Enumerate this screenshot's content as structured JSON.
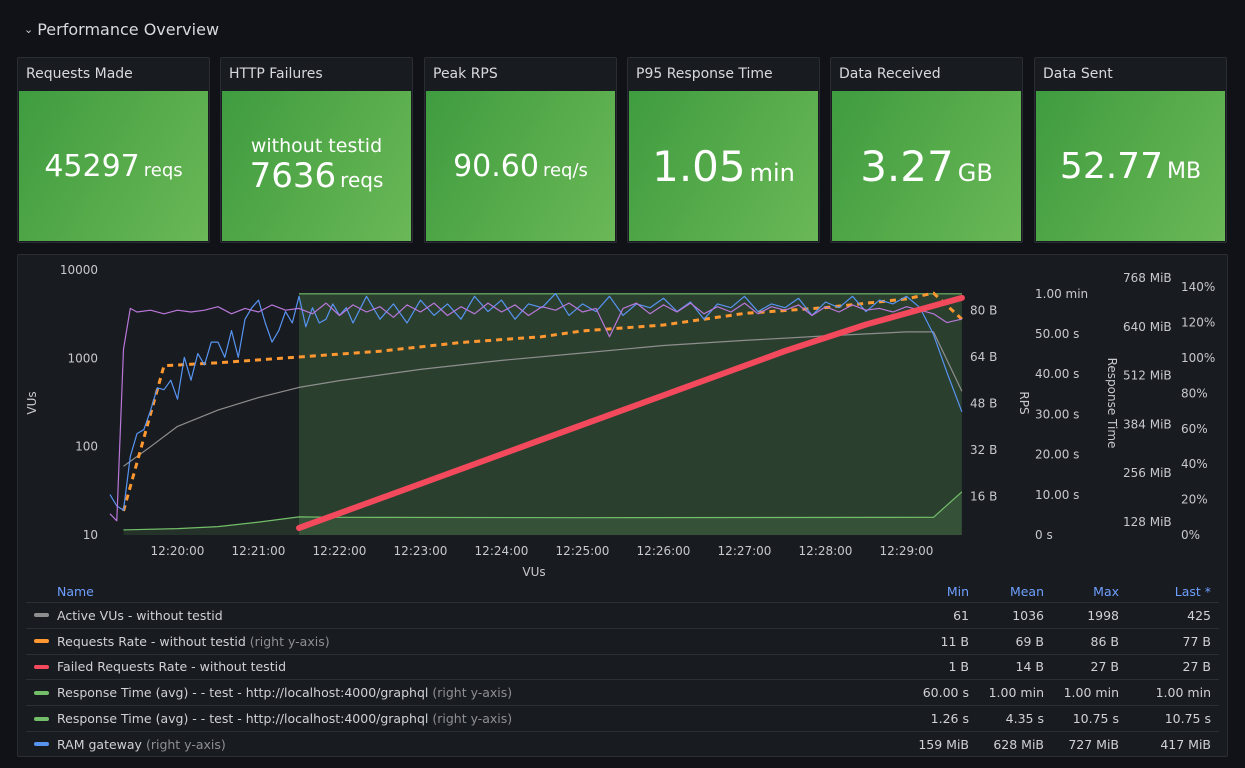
{
  "row": {
    "title": "Performance Overview",
    "icon": "chevron-down-icon"
  },
  "stats": [
    {
      "title": "Requests Made",
      "value": "45297",
      "unit": "reqs"
    },
    {
      "title": "HTTP Failures",
      "subtitle": "without testid",
      "value": "7636",
      "unit": "reqs"
    },
    {
      "title": "Peak RPS",
      "value": "90.60",
      "unit": "req/s"
    },
    {
      "title": "P95 Response Time",
      "value": "1.05",
      "unit": "min"
    },
    {
      "title": "Data Received",
      "value": "3.27",
      "unit": "GB"
    },
    {
      "title": "Data Sent",
      "value": "52.77",
      "unit": "MB"
    }
  ],
  "colors": {
    "stat_green": "#56a64b",
    "vus": "#8e8e8e",
    "requests": "#ff9830",
    "failed": "#f2495c",
    "response": "#73bf69",
    "ram": "#5794f2",
    "purple": "#b877d9"
  },
  "chart_data": {
    "type": "line",
    "xlabel": "VUs",
    "x_ticks": [
      "12:20:00",
      "12:21:00",
      "12:22:00",
      "12:23:00",
      "12:24:00",
      "12:25:00",
      "12:26:00",
      "12:27:00",
      "12:28:00",
      "12:29:00"
    ],
    "x_range": [
      "12:19:10",
      "12:29:41"
    ],
    "axes": {
      "vus": {
        "label": "VUs",
        "scale": "log",
        "range": [
          10,
          10000
        ],
        "ticks": [
          "10",
          "100",
          "1000",
          "10000"
        ],
        "side": "left"
      },
      "bytes": {
        "label": "RPS",
        "scale": "linear",
        "ticks": [
          "16 B",
          "32 B",
          "48 B",
          "64 B",
          "80 B"
        ],
        "side": "right"
      },
      "time": {
        "label": "",
        "scale": "linear",
        "range": [
          0,
          60
        ],
        "ticks": [
          "0 s",
          "10.00 s",
          "20.00 s",
          "30.00 s",
          "40.00 s",
          "50.00 s",
          "1.00 min"
        ],
        "side": "right"
      },
      "mib": {
        "label": "Response Time",
        "scale": "linear",
        "ticks": [
          "128 MiB",
          "256 MiB",
          "384 MiB",
          "512 MiB",
          "640 MiB",
          "768 MiB"
        ],
        "side": "right"
      },
      "percent": {
        "label": "",
        "scale": "linear",
        "range": [
          0,
          140
        ],
        "ticks": [
          "0%",
          "20%",
          "40%",
          "60%",
          "80%",
          "100%",
          "120%",
          "140%"
        ],
        "side": "right"
      }
    },
    "series": [
      {
        "name": "Active VUs - without testid",
        "axis": "vus",
        "color": "#8e8e8e",
        "style": "solid",
        "points": [
          [
            "12:19:20",
            60
          ],
          [
            "12:19:40",
            100
          ],
          [
            "12:20:00",
            170
          ],
          [
            "12:20:30",
            260
          ],
          [
            "12:21:00",
            360
          ],
          [
            "12:21:30",
            470
          ],
          [
            "12:22:00",
            560
          ],
          [
            "12:23:00",
            750
          ],
          [
            "12:24:00",
            950
          ],
          [
            "12:25:00",
            1150
          ],
          [
            "12:26:00",
            1400
          ],
          [
            "12:27:00",
            1600
          ],
          [
            "12:28:00",
            1800
          ],
          [
            "12:29:00",
            1998
          ],
          [
            "12:29:20",
            1998
          ],
          [
            "12:29:41",
            425
          ]
        ]
      },
      {
        "name": "Requests Rate - without testid",
        "axis_note": "(right y-axis)",
        "axis": "bytes",
        "color": "#ff9830",
        "style": "dashed",
        "points": [
          [
            "12:19:20",
            11
          ],
          [
            "12:19:50",
            61
          ],
          [
            "12:20:30",
            62
          ],
          [
            "12:21:30",
            64
          ],
          [
            "12:22:30",
            66
          ],
          [
            "12:23:30",
            69
          ],
          [
            "12:24:30",
            71
          ],
          [
            "12:25:00",
            73
          ],
          [
            "12:26:00",
            75
          ],
          [
            "12:27:00",
            79
          ],
          [
            "12:28:00",
            81
          ],
          [
            "12:29:00",
            84
          ],
          [
            "12:29:20",
            86
          ],
          [
            "12:29:41",
            77
          ]
        ]
      },
      {
        "name": "Failed Requests Rate - without testid",
        "axis": "failed",
        "color": "#f2495c",
        "style": "thick",
        "points": [
          [
            "12:21:30",
            1
          ],
          [
            "12:23:00",
            6
          ],
          [
            "12:24:30",
            11
          ],
          [
            "12:26:00",
            16
          ],
          [
            "12:27:30",
            21
          ],
          [
            "12:28:30",
            24
          ],
          [
            "12:29:41",
            27
          ]
        ]
      },
      {
        "name": "Response Time (avg) - - test - http://localhost:4000/graphql",
        "axis_note": "(right y-axis)",
        "axis": "time",
        "color": "#73bf69",
        "style": "fill",
        "points": [
          [
            "12:21:30",
            60
          ],
          [
            "12:29:41",
            60
          ]
        ]
      },
      {
        "name": "Response Time (avg) - - test - http://localhost:4000/graphql",
        "axis_note": "(right y-axis)",
        "axis": "time",
        "color": "#73bf69",
        "style": "solid",
        "points": [
          [
            "12:19:20",
            1.26
          ],
          [
            "12:20:00",
            1.6
          ],
          [
            "12:20:30",
            2.1
          ],
          [
            "12:21:00",
            3.2
          ],
          [
            "12:21:30",
            4.5
          ],
          [
            "12:22:00",
            4.4
          ],
          [
            "12:25:00",
            4.3
          ],
          [
            "12:29:20",
            4.4
          ],
          [
            "12:29:41",
            10.75
          ]
        ]
      },
      {
        "name": "RAM gateway",
        "axis_note": "(right y-axis)",
        "axis": "mib",
        "color": "#5794f2",
        "style": "solid",
        "points": [
          [
            "12:19:10",
            200
          ],
          [
            "12:19:15",
            170
          ],
          [
            "12:19:20",
            159
          ],
          [
            "12:19:25",
            300
          ],
          [
            "12:19:30",
            360
          ],
          [
            "12:19:35",
            370
          ],
          [
            "12:19:40",
            420
          ],
          [
            "12:19:45",
            480
          ],
          [
            "12:19:50",
            475
          ],
          [
            "12:19:55",
            500
          ],
          [
            "12:20:00",
            450
          ],
          [
            "12:20:05",
            560
          ],
          [
            "12:20:10",
            500
          ],
          [
            "12:20:15",
            570
          ],
          [
            "12:20:20",
            540
          ],
          [
            "12:20:25",
            600
          ],
          [
            "12:20:30",
            600
          ],
          [
            "12:20:35",
            560
          ],
          [
            "12:20:40",
            630
          ],
          [
            "12:20:45",
            560
          ],
          [
            "12:20:50",
            660
          ],
          [
            "12:20:55",
            690
          ],
          [
            "12:21:00",
            710
          ],
          [
            "12:21:05",
            650
          ],
          [
            "12:21:10",
            600
          ],
          [
            "12:21:15",
            630
          ],
          [
            "12:21:20",
            680
          ],
          [
            "12:21:25",
            650
          ],
          [
            "12:21:30",
            720
          ],
          [
            "12:21:35",
            640
          ],
          [
            "12:21:40",
            690
          ],
          [
            "12:21:45",
            650
          ],
          [
            "12:21:50",
            660
          ],
          [
            "12:21:55",
            700
          ],
          [
            "12:22:00",
            670
          ],
          [
            "12:22:05",
            690
          ],
          [
            "12:22:10",
            650
          ],
          [
            "12:22:20",
            720
          ],
          [
            "12:22:30",
            660
          ],
          [
            "12:22:40",
            700
          ],
          [
            "12:22:50",
            650
          ],
          [
            "12:23:00",
            710
          ],
          [
            "12:23:10",
            670
          ],
          [
            "12:23:20",
            700
          ],
          [
            "12:23:30",
            660
          ],
          [
            "12:23:40",
            720
          ],
          [
            "12:23:50",
            680
          ],
          [
            "12:24:00",
            710
          ],
          [
            "12:24:10",
            660
          ],
          [
            "12:24:20",
            700
          ],
          [
            "12:24:30",
            690
          ],
          [
            "12:24:40",
            727
          ],
          [
            "12:24:50",
            670
          ],
          [
            "12:25:00",
            700
          ],
          [
            "12:25:10",
            680
          ],
          [
            "12:25:20",
            720
          ],
          [
            "12:25:30",
            670
          ],
          [
            "12:25:40",
            700
          ],
          [
            "12:25:50",
            690
          ],
          [
            "12:26:00",
            715
          ],
          [
            "12:26:10",
            680
          ],
          [
            "12:26:20",
            705
          ],
          [
            "12:26:30",
            660
          ],
          [
            "12:26:40",
            700
          ],
          [
            "12:26:50",
            690
          ],
          [
            "12:27:00",
            720
          ],
          [
            "12:27:10",
            680
          ],
          [
            "12:27:20",
            700
          ],
          [
            "12:27:30",
            690
          ],
          [
            "12:27:40",
            715
          ],
          [
            "12:27:50",
            670
          ],
          [
            "12:28:00",
            705
          ],
          [
            "12:28:10",
            690
          ],
          [
            "12:28:20",
            720
          ],
          [
            "12:28:30",
            680
          ],
          [
            "12:28:40",
            710
          ],
          [
            "12:28:50",
            700
          ],
          [
            "12:29:00",
            720
          ],
          [
            "12:29:10",
            690
          ],
          [
            "12:29:20",
            620
          ],
          [
            "12:29:30",
            520
          ],
          [
            "12:29:41",
            417
          ]
        ]
      },
      {
        "axis": "percent",
        "color": "#b877d9",
        "style": "solid",
        "points": [
          [
            "12:19:10",
            12
          ],
          [
            "12:19:15",
            8
          ],
          [
            "12:19:20",
            105
          ],
          [
            "12:19:25",
            128
          ],
          [
            "12:19:30",
            126
          ],
          [
            "12:19:40",
            127
          ],
          [
            "12:19:50",
            125
          ],
          [
            "12:20:00",
            127
          ],
          [
            "12:20:10",
            126
          ],
          [
            "12:20:20",
            127
          ],
          [
            "12:20:30",
            129
          ],
          [
            "12:20:40",
            125
          ],
          [
            "12:20:50",
            128
          ],
          [
            "12:21:00",
            126
          ],
          [
            "12:21:10",
            130
          ],
          [
            "12:21:20",
            127
          ],
          [
            "12:21:30",
            128
          ],
          [
            "12:21:40",
            125
          ],
          [
            "12:21:50",
            131
          ],
          [
            "12:22:00",
            124
          ],
          [
            "12:22:10",
            130
          ],
          [
            "12:22:20",
            126
          ],
          [
            "12:22:30",
            129
          ],
          [
            "12:22:40",
            123
          ],
          [
            "12:22:50",
            130
          ],
          [
            "12:23:00",
            126
          ],
          [
            "12:23:10",
            131
          ],
          [
            "12:23:20",
            124
          ],
          [
            "12:23:30",
            129
          ],
          [
            "12:23:40",
            125
          ],
          [
            "12:23:50",
            131
          ],
          [
            "12:24:00",
            126
          ],
          [
            "12:24:10",
            130
          ],
          [
            "12:24:20",
            124
          ],
          [
            "12:24:30",
            129
          ],
          [
            "12:24:40",
            127
          ],
          [
            "12:24:50",
            131
          ],
          [
            "12:25:00",
            126
          ],
          [
            "12:25:10",
            128
          ],
          [
            "12:25:20",
            112
          ],
          [
            "12:25:30",
            128
          ],
          [
            "12:25:40",
            131
          ],
          [
            "12:25:50",
            125
          ],
          [
            "12:26:00",
            130
          ],
          [
            "12:26:10",
            126
          ],
          [
            "12:26:20",
            131
          ],
          [
            "12:26:30",
            125
          ],
          [
            "12:26:40",
            129
          ],
          [
            "12:26:50",
            126
          ],
          [
            "12:27:00",
            131
          ],
          [
            "12:27:10",
            125
          ],
          [
            "12:27:20",
            129
          ],
          [
            "12:27:30",
            127
          ],
          [
            "12:27:40",
            130
          ],
          [
            "12:27:50",
            124
          ],
          [
            "12:28:00",
            129
          ],
          [
            "12:28:10",
            126
          ],
          [
            "12:28:20",
            130
          ],
          [
            "12:28:30",
            127
          ],
          [
            "12:28:40",
            128
          ],
          [
            "12:28:50",
            126
          ],
          [
            "12:29:00",
            129
          ],
          [
            "12:29:10",
            127
          ],
          [
            "12:29:20",
            125
          ],
          [
            "12:29:30",
            120
          ],
          [
            "12:29:41",
            122
          ]
        ]
      }
    ]
  },
  "legend": {
    "headers": {
      "name": "Name",
      "min": "Min",
      "mean": "Mean",
      "max": "Max",
      "last": "Last *"
    },
    "rows": [
      {
        "name": "Active VUs - without testid",
        "note": "",
        "color": "#8e8e8e",
        "min": "61",
        "mean": "1036",
        "max": "1998",
        "last": "425"
      },
      {
        "name": "Requests Rate - without testid",
        "note": "(right y-axis)",
        "color": "#ff9830",
        "min": "11 B",
        "mean": "69 B",
        "max": "86 B",
        "last": "77 B"
      },
      {
        "name": "Failed Requests Rate - without testid",
        "note": "",
        "color": "#f2495c",
        "min": "1 B",
        "mean": "14 B",
        "max": "27 B",
        "last": "27 B"
      },
      {
        "name": "Response Time (avg) - - test - http://localhost:4000/graphql",
        "note": "(right y-axis)",
        "color": "#73bf69",
        "min": "60.00 s",
        "mean": "1.00 min",
        "max": "1.00 min",
        "last": "1.00 min"
      },
      {
        "name": "Response Time (avg) - - test - http://localhost:4000/graphql",
        "note": "(right y-axis)",
        "color": "#73bf69",
        "min": "1.26 s",
        "mean": "4.35 s",
        "max": "10.75 s",
        "last": "10.75 s"
      },
      {
        "name": "RAM gateway",
        "note": "(right y-axis)",
        "color": "#5794f2",
        "min": "159 MiB",
        "mean": "628 MiB",
        "max": "727 MiB",
        "last": "417 MiB"
      }
    ]
  }
}
